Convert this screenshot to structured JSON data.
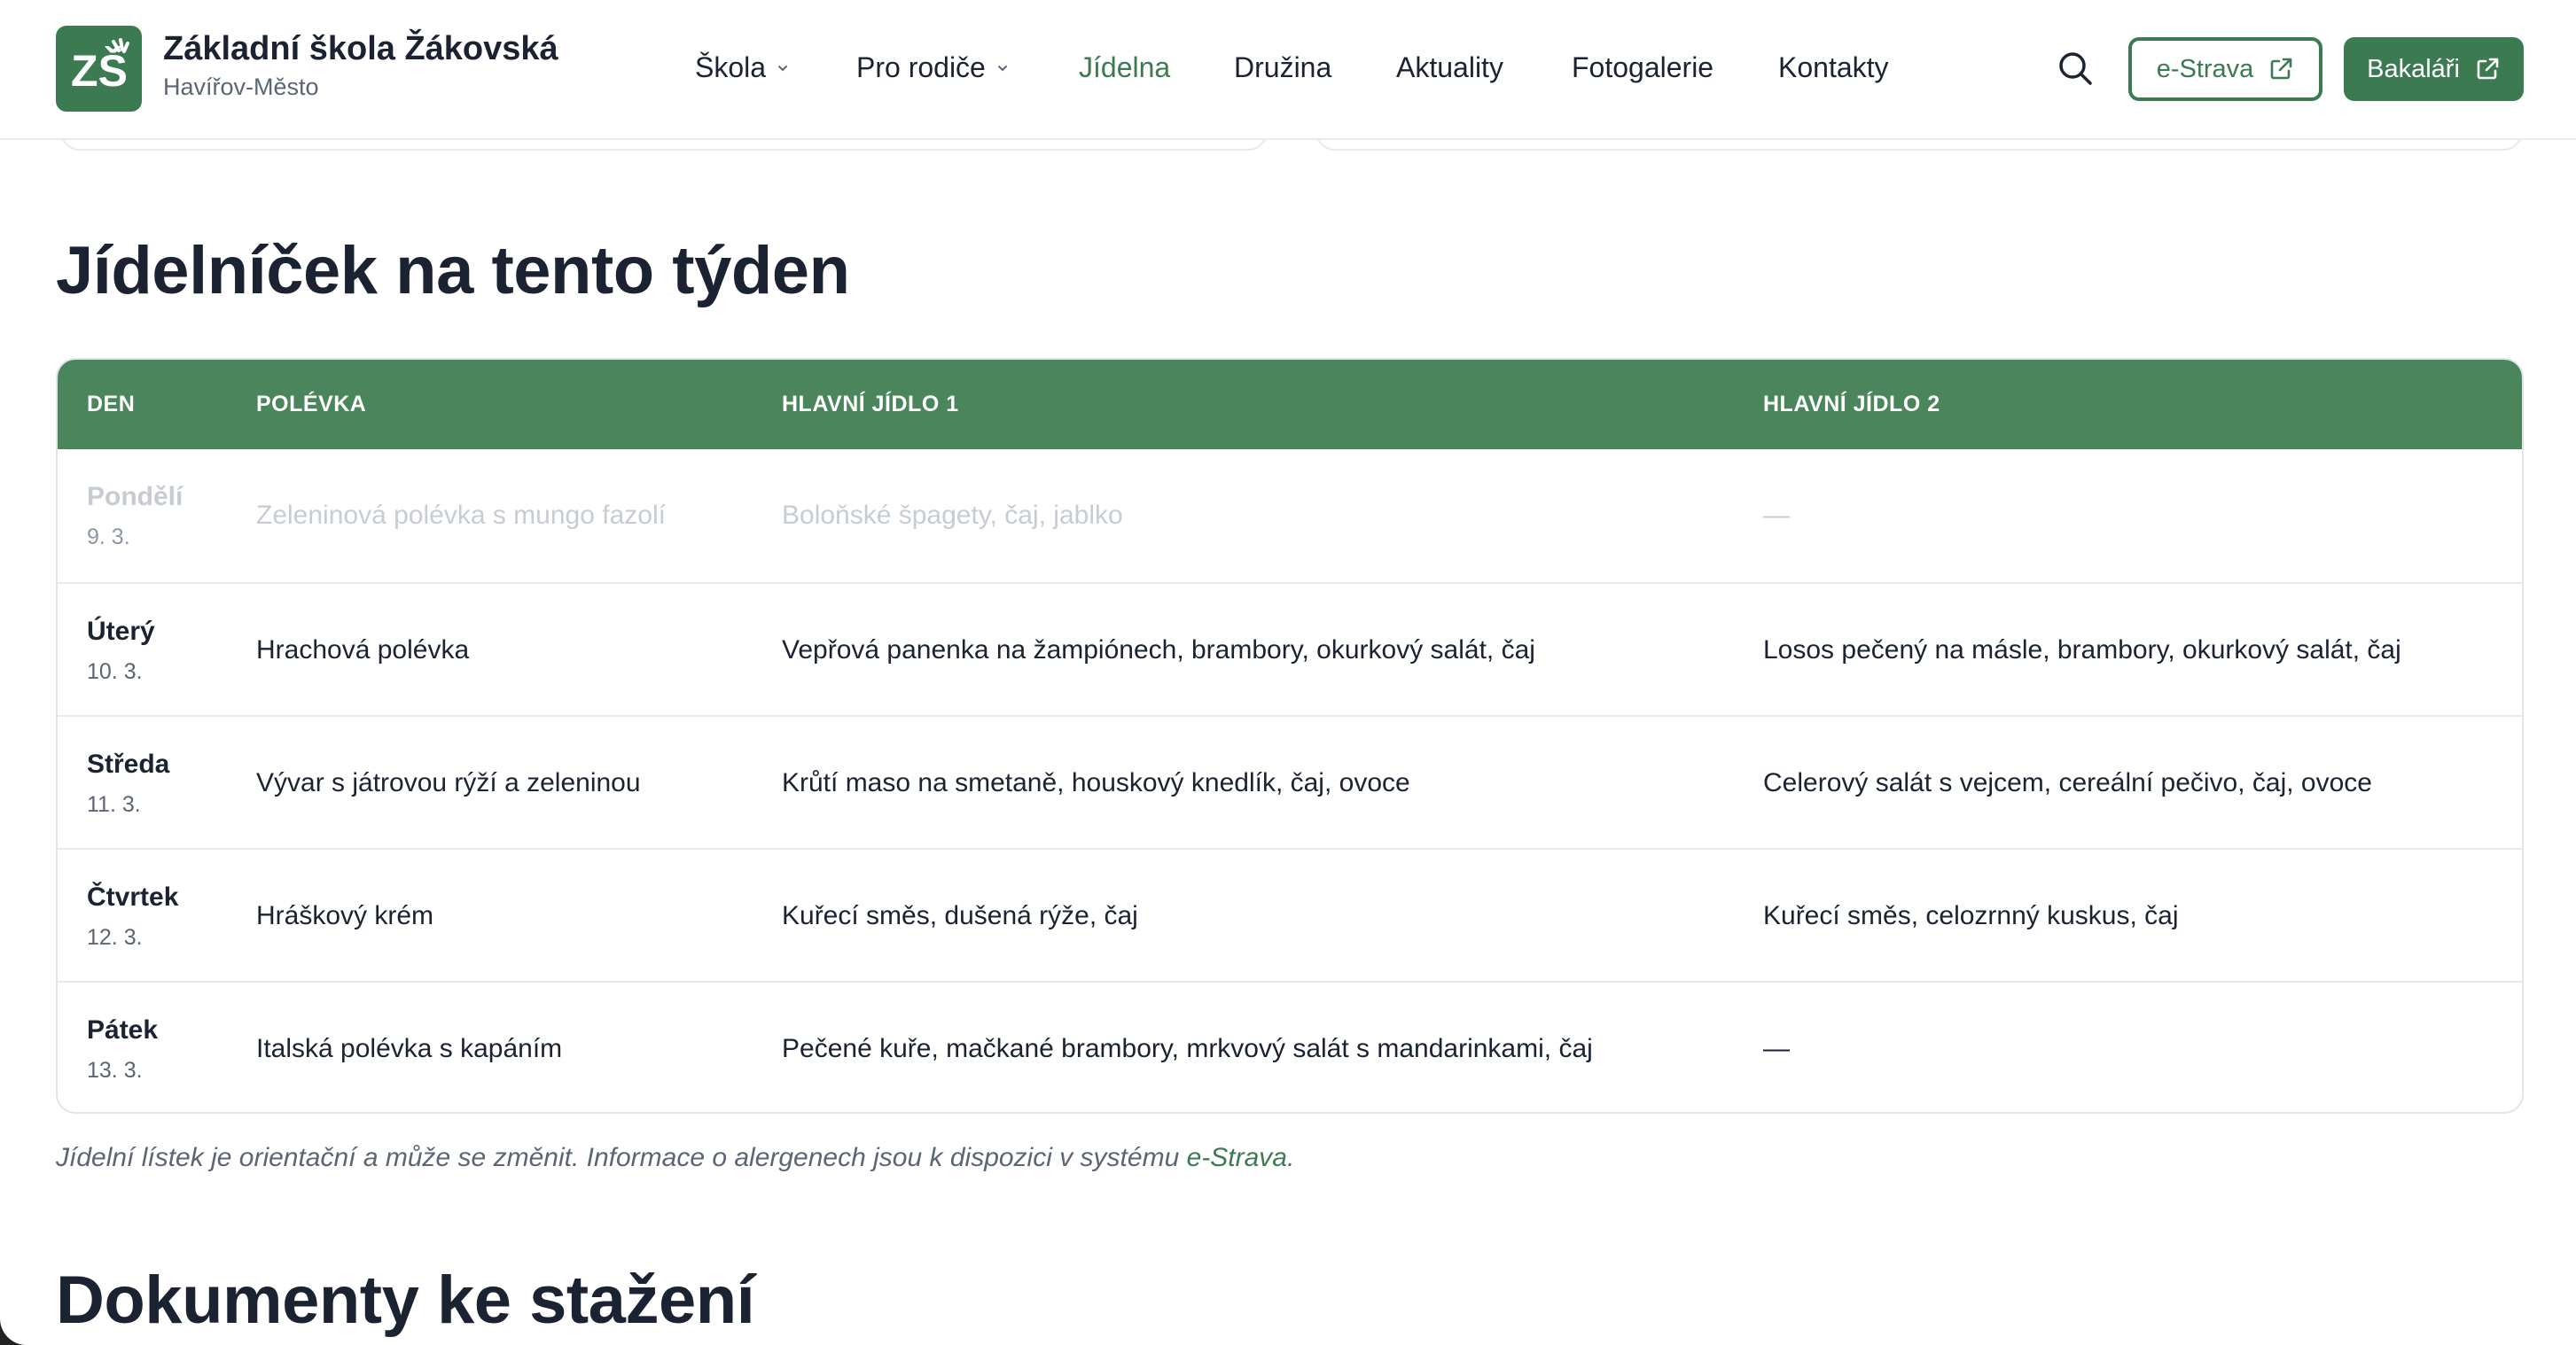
{
  "brand": {
    "title": "Základní škola Žákovská",
    "subtitle": "Havířov-Město",
    "logo_text": "ZŠ",
    "accent": "#3c7a52"
  },
  "nav": {
    "items": [
      {
        "label": "Škola",
        "has_dropdown": true
      },
      {
        "label": "Pro rodiče",
        "has_dropdown": true
      },
      {
        "label": "Jídelna",
        "active": true
      },
      {
        "label": "Družina"
      },
      {
        "label": "Aktuality"
      },
      {
        "label": "Fotogalerie"
      },
      {
        "label": "Kontakty"
      }
    ],
    "search_icon": "search-icon",
    "estrava_label": "e-Strava",
    "bakalari_label": "Bakaláři",
    "external_icon": "external-link-icon"
  },
  "menu": {
    "title": "Jídelníček na tento týden",
    "headers": [
      "DEN",
      "POLÉVKA",
      "HLAVNÍ JÍDLO 1",
      "HLAVNÍ JÍDLO 2"
    ],
    "rows": [
      {
        "day": "Pondělí",
        "date": "9. 3.",
        "soup": "Zeleninová polévka s mungo fazolí",
        "main1": "Boloňské špagety, čaj, jablko",
        "main2": "—",
        "past": true
      },
      {
        "day": "Úterý",
        "date": "10. 3.",
        "soup": "Hrachová polévka",
        "main1": "Vepřová panenka na žampiónech, brambory, okurkový salát, čaj",
        "main2": "Losos pečený na másle, brambory, okurkový salát, čaj"
      },
      {
        "day": "Středa",
        "date": "11. 3.",
        "soup": "Vývar s játrovou rýží a zeleninou",
        "main1": "Krůtí maso na smetaně, houskový knedlík, čaj, ovoce",
        "main2": "Celerový salát s vejcem, cereální pečivo, čaj, ovoce"
      },
      {
        "day": "Čtvrtek",
        "date": "12. 3.",
        "soup": "Hráškový krém",
        "main1": "Kuřecí směs, dušená rýže, čaj",
        "main2": "Kuřecí směs, celozrnný kuskus, čaj"
      },
      {
        "day": "Pátek",
        "date": "13. 3.",
        "soup": "Italská polévka s kapáním",
        "main1": "Pečené kuře, mačkané brambory, mrkvový salát s mandarinkami, čaj",
        "main2": "—"
      }
    ],
    "note_prefix": "Jídelní lístek je orientační a může se změnit. Informace o alergenech jsou k dispozici v systému ",
    "note_link": "e-Strava",
    "note_suffix": "."
  },
  "documents": {
    "title": "Dokumenty ke stažení"
  }
}
